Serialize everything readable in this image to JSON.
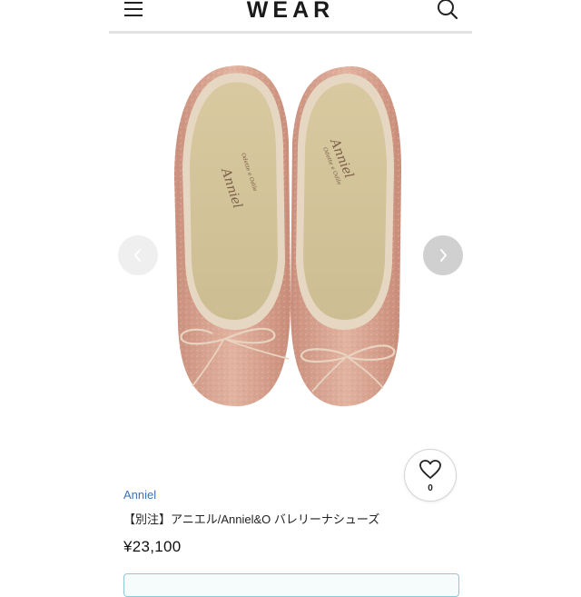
{
  "header": {
    "logo": "WEAR",
    "menu_icon": "hamburger-menu-icon",
    "search_icon": "search-icon"
  },
  "product": {
    "brand": "Anniel",
    "title": "【別注】アニエル/Anniel&O バレリーナシューズ",
    "price": "¥23,100",
    "insole_print": "Anniel",
    "likes": "0"
  },
  "gallery": {
    "prev_icon": "chevron-left-icon",
    "next_icon": "chevron-right-icon"
  },
  "colors": {
    "brand_link": "#3a74b3",
    "shoe_body": "#d8a490",
    "insole": "#d8cba4",
    "button_border": "#8ecad4"
  }
}
